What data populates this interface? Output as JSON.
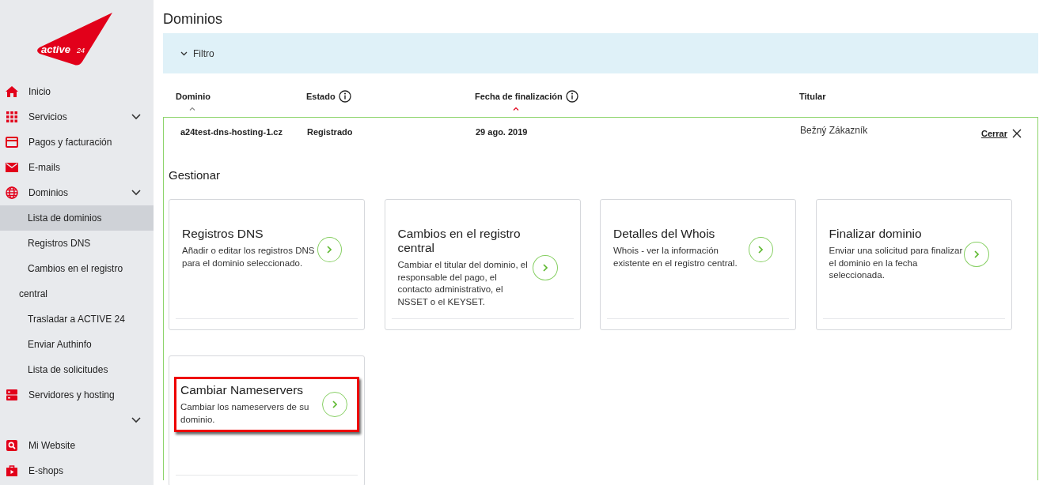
{
  "logo": {
    "text": "active",
    "number": "24"
  },
  "sidebar": {
    "items": [
      {
        "label": "Inicio",
        "kind": "link",
        "selected": false
      },
      {
        "label": "Servicios",
        "kind": "group",
        "selected": false
      },
      {
        "label": "Pagos y facturación",
        "kind": "link",
        "selected": false
      },
      {
        "label": "E-mails",
        "kind": "link",
        "selected": false
      },
      {
        "label": "Dominios",
        "kind": "group",
        "selected": false
      },
      {
        "label": "Lista de dominios",
        "kind": "sub",
        "selected": true
      },
      {
        "label": "Registros DNS",
        "kind": "sub",
        "selected": false
      },
      {
        "label": "Cambios en el registro central",
        "kind": "sub",
        "selected": false
      },
      {
        "label": "Trasladar a ACTIVE 24",
        "kind": "sub",
        "selected": false
      },
      {
        "label": "Enviar Authinfo",
        "kind": "sub",
        "selected": false
      },
      {
        "label": "Lista de solicitudes",
        "kind": "sub",
        "selected": false
      },
      {
        "label": "Servidores y hosting",
        "kind": "group_wrap",
        "selected": false
      },
      {
        "label": "Mi Website",
        "kind": "link",
        "selected": false
      },
      {
        "label": "E-shops",
        "kind": "link",
        "selected": false
      }
    ]
  },
  "page": {
    "title": "Dominios",
    "filter": {
      "label": "Filtro",
      "expanded": false
    }
  },
  "table": {
    "columns": [
      {
        "label": "Dominio",
        "kind": "sortable",
        "sorted": false,
        "info": false
      },
      {
        "label": "Estado",
        "kind": "plain",
        "info": true
      },
      {
        "label": "Fecha de finalización",
        "kind": "sortable",
        "sorted": true,
        "info": true
      },
      {
        "label": "Titular",
        "kind": "plain",
        "info": false
      }
    ],
    "expanded_row": {
      "cells": [
        "a24test-dns-hosting-1.cz",
        "Registrado",
        "29 ago. 2019",
        "Bežný Zákazník"
      ],
      "close_label": "Cerrar"
    }
  },
  "manage": {
    "title": "Gestionar",
    "cards": [
      {
        "title": "Registros DNS",
        "description": "Añadir o editar los registros DNS para el dominio seleccionado.",
        "highlighted": false
      },
      {
        "title": "Cambios en el registro central",
        "description": "Cambiar el titular del dominio, el responsable del pago, el contacto administrativo, el NSSET o el KEYSET.",
        "highlighted": false
      },
      {
        "title": "Detalles del Whois",
        "description": "Whois - ver la información existente en el registro central.",
        "highlighted": false
      },
      {
        "title": "Finalizar dominio",
        "description": "Enviar una solicitud para finalizar el dominio en la fecha seleccionada.",
        "highlighted": false
      },
      {
        "title": "Cambiar Nameservers",
        "description": "Cambiar los nameservers de su dominio.",
        "highlighted": true
      }
    ]
  }
}
